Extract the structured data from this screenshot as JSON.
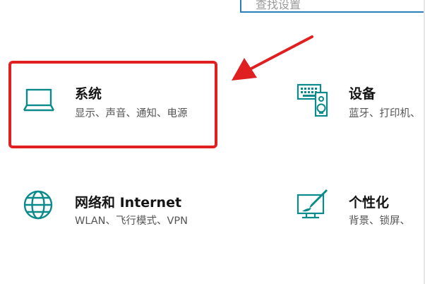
{
  "search": {
    "text": "查找设置"
  },
  "tiles": [
    {
      "title": "系统",
      "subtitle": "显示、声音、通知、电源",
      "icon": "laptop-icon"
    },
    {
      "title": "设备",
      "subtitle": "蓝牙、打印机、",
      "icon": "keyboard-speaker-icon"
    },
    {
      "title": "网络和 Internet",
      "subtitle": "WLAN、飞行模式、VPN",
      "icon": "globe-icon"
    },
    {
      "title": "个性化",
      "subtitle": "背景、锁屏、",
      "icon": "paint-canvas-icon"
    }
  ],
  "colors": {
    "accent": "#0b8a8c",
    "highlight": "#e02020",
    "search_border": "#2b7fb8"
  }
}
